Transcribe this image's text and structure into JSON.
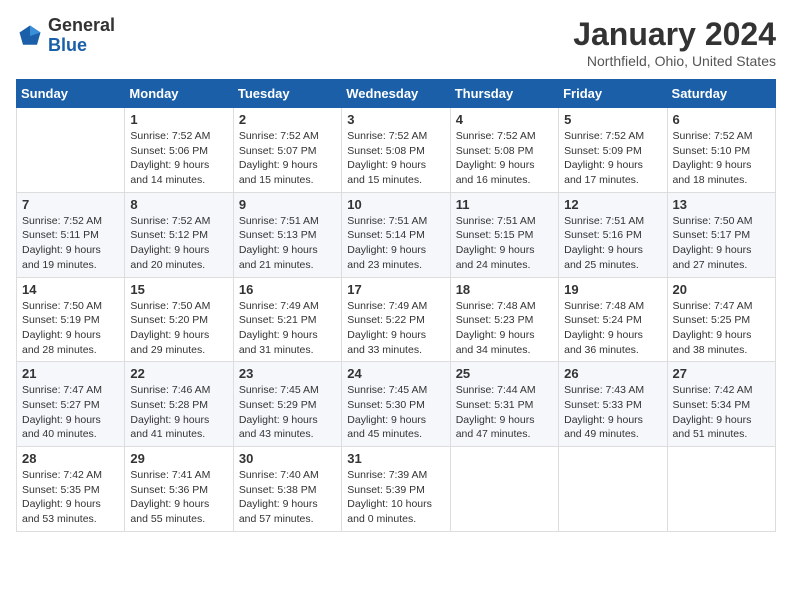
{
  "header": {
    "logo_general": "General",
    "logo_blue": "Blue",
    "month_title": "January 2024",
    "location": "Northfield, Ohio, United States"
  },
  "weekdays": [
    "Sunday",
    "Monday",
    "Tuesday",
    "Wednesday",
    "Thursday",
    "Friday",
    "Saturday"
  ],
  "weeks": [
    [
      {
        "day": "",
        "sunrise": "",
        "sunset": "",
        "daylight": ""
      },
      {
        "day": "1",
        "sunrise": "Sunrise: 7:52 AM",
        "sunset": "Sunset: 5:06 PM",
        "daylight": "Daylight: 9 hours and 14 minutes."
      },
      {
        "day": "2",
        "sunrise": "Sunrise: 7:52 AM",
        "sunset": "Sunset: 5:07 PM",
        "daylight": "Daylight: 9 hours and 15 minutes."
      },
      {
        "day": "3",
        "sunrise": "Sunrise: 7:52 AM",
        "sunset": "Sunset: 5:08 PM",
        "daylight": "Daylight: 9 hours and 15 minutes."
      },
      {
        "day": "4",
        "sunrise": "Sunrise: 7:52 AM",
        "sunset": "Sunset: 5:08 PM",
        "daylight": "Daylight: 9 hours and 16 minutes."
      },
      {
        "day": "5",
        "sunrise": "Sunrise: 7:52 AM",
        "sunset": "Sunset: 5:09 PM",
        "daylight": "Daylight: 9 hours and 17 minutes."
      },
      {
        "day": "6",
        "sunrise": "Sunrise: 7:52 AM",
        "sunset": "Sunset: 5:10 PM",
        "daylight": "Daylight: 9 hours and 18 minutes."
      }
    ],
    [
      {
        "day": "7",
        "sunrise": "Sunrise: 7:52 AM",
        "sunset": "Sunset: 5:11 PM",
        "daylight": "Daylight: 9 hours and 19 minutes."
      },
      {
        "day": "8",
        "sunrise": "Sunrise: 7:52 AM",
        "sunset": "Sunset: 5:12 PM",
        "daylight": "Daylight: 9 hours and 20 minutes."
      },
      {
        "day": "9",
        "sunrise": "Sunrise: 7:51 AM",
        "sunset": "Sunset: 5:13 PM",
        "daylight": "Daylight: 9 hours and 21 minutes."
      },
      {
        "day": "10",
        "sunrise": "Sunrise: 7:51 AM",
        "sunset": "Sunset: 5:14 PM",
        "daylight": "Daylight: 9 hours and 23 minutes."
      },
      {
        "day": "11",
        "sunrise": "Sunrise: 7:51 AM",
        "sunset": "Sunset: 5:15 PM",
        "daylight": "Daylight: 9 hours and 24 minutes."
      },
      {
        "day": "12",
        "sunrise": "Sunrise: 7:51 AM",
        "sunset": "Sunset: 5:16 PM",
        "daylight": "Daylight: 9 hours and 25 minutes."
      },
      {
        "day": "13",
        "sunrise": "Sunrise: 7:50 AM",
        "sunset": "Sunset: 5:17 PM",
        "daylight": "Daylight: 9 hours and 27 minutes."
      }
    ],
    [
      {
        "day": "14",
        "sunrise": "Sunrise: 7:50 AM",
        "sunset": "Sunset: 5:19 PM",
        "daylight": "Daylight: 9 hours and 28 minutes."
      },
      {
        "day": "15",
        "sunrise": "Sunrise: 7:50 AM",
        "sunset": "Sunset: 5:20 PM",
        "daylight": "Daylight: 9 hours and 29 minutes."
      },
      {
        "day": "16",
        "sunrise": "Sunrise: 7:49 AM",
        "sunset": "Sunset: 5:21 PM",
        "daylight": "Daylight: 9 hours and 31 minutes."
      },
      {
        "day": "17",
        "sunrise": "Sunrise: 7:49 AM",
        "sunset": "Sunset: 5:22 PM",
        "daylight": "Daylight: 9 hours and 33 minutes."
      },
      {
        "day": "18",
        "sunrise": "Sunrise: 7:48 AM",
        "sunset": "Sunset: 5:23 PM",
        "daylight": "Daylight: 9 hours and 34 minutes."
      },
      {
        "day": "19",
        "sunrise": "Sunrise: 7:48 AM",
        "sunset": "Sunset: 5:24 PM",
        "daylight": "Daylight: 9 hours and 36 minutes."
      },
      {
        "day": "20",
        "sunrise": "Sunrise: 7:47 AM",
        "sunset": "Sunset: 5:25 PM",
        "daylight": "Daylight: 9 hours and 38 minutes."
      }
    ],
    [
      {
        "day": "21",
        "sunrise": "Sunrise: 7:47 AM",
        "sunset": "Sunset: 5:27 PM",
        "daylight": "Daylight: 9 hours and 40 minutes."
      },
      {
        "day": "22",
        "sunrise": "Sunrise: 7:46 AM",
        "sunset": "Sunset: 5:28 PM",
        "daylight": "Daylight: 9 hours and 41 minutes."
      },
      {
        "day": "23",
        "sunrise": "Sunrise: 7:45 AM",
        "sunset": "Sunset: 5:29 PM",
        "daylight": "Daylight: 9 hours and 43 minutes."
      },
      {
        "day": "24",
        "sunrise": "Sunrise: 7:45 AM",
        "sunset": "Sunset: 5:30 PM",
        "daylight": "Daylight: 9 hours and 45 minutes."
      },
      {
        "day": "25",
        "sunrise": "Sunrise: 7:44 AM",
        "sunset": "Sunset: 5:31 PM",
        "daylight": "Daylight: 9 hours and 47 minutes."
      },
      {
        "day": "26",
        "sunrise": "Sunrise: 7:43 AM",
        "sunset": "Sunset: 5:33 PM",
        "daylight": "Daylight: 9 hours and 49 minutes."
      },
      {
        "day": "27",
        "sunrise": "Sunrise: 7:42 AM",
        "sunset": "Sunset: 5:34 PM",
        "daylight": "Daylight: 9 hours and 51 minutes."
      }
    ],
    [
      {
        "day": "28",
        "sunrise": "Sunrise: 7:42 AM",
        "sunset": "Sunset: 5:35 PM",
        "daylight": "Daylight: 9 hours and 53 minutes."
      },
      {
        "day": "29",
        "sunrise": "Sunrise: 7:41 AM",
        "sunset": "Sunset: 5:36 PM",
        "daylight": "Daylight: 9 hours and 55 minutes."
      },
      {
        "day": "30",
        "sunrise": "Sunrise: 7:40 AM",
        "sunset": "Sunset: 5:38 PM",
        "daylight": "Daylight: 9 hours and 57 minutes."
      },
      {
        "day": "31",
        "sunrise": "Sunrise: 7:39 AM",
        "sunset": "Sunset: 5:39 PM",
        "daylight": "Daylight: 10 hours and 0 minutes."
      },
      {
        "day": "",
        "sunrise": "",
        "sunset": "",
        "daylight": ""
      },
      {
        "day": "",
        "sunrise": "",
        "sunset": "",
        "daylight": ""
      },
      {
        "day": "",
        "sunrise": "",
        "sunset": "",
        "daylight": ""
      }
    ]
  ]
}
